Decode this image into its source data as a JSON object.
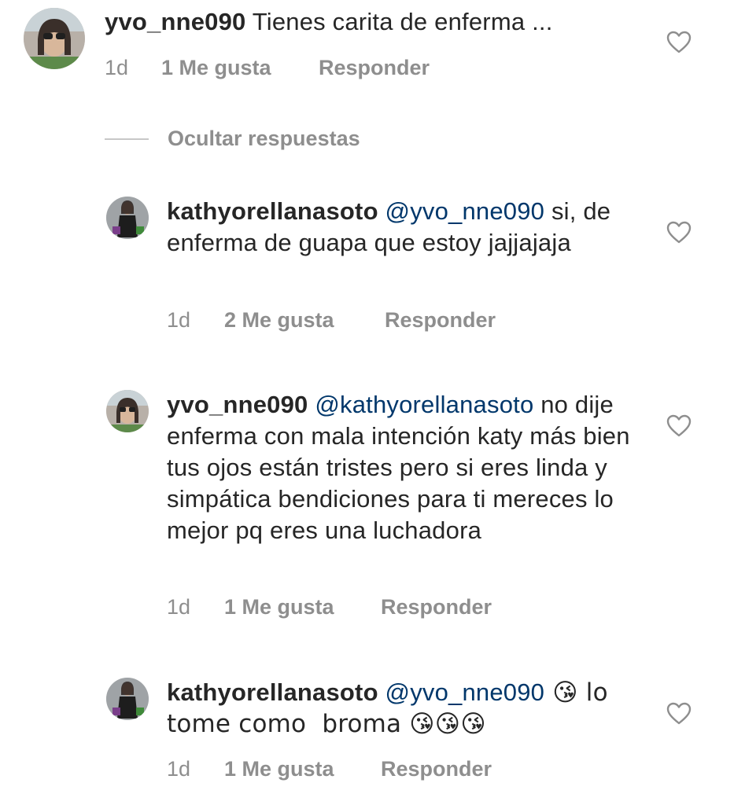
{
  "comments": [
    {
      "username": "yvo_nne090",
      "mention": "",
      "text": " Tienes carita de enferma ...",
      "time": "1d",
      "likes": "1 Me gusta",
      "reply": "Responder"
    },
    {
      "username": "kathyorellanasoto",
      "mention": "@yvo_nne090",
      "text": " si, de enferma de guapa que estoy jajjajaja",
      "time": "1d",
      "likes": "2 Me gusta",
      "reply": "Responder"
    },
    {
      "username": "yvo_nne090",
      "mention": "@kathyorellanasoto",
      "text": " no dije enferma con mala intención katy más bien tus ojos están tristes pero si eres linda y simpática bendiciones para ti mereces lo mejor pq eres una luchadora",
      "time": "1d",
      "likes": "1 Me gusta",
      "reply": "Responder"
    },
    {
      "username": "kathyorellanasoto",
      "mention": "@yvo_nne090",
      "text": " 😘 lo tome como  broma 😘😘😘",
      "time": "1d",
      "likes": "1 Me gusta",
      "reply": "Responder"
    }
  ],
  "replies_toggle": "Ocultar respuestas",
  "icons": {
    "like": "heart-outline-icon"
  },
  "colors": {
    "text": "#262626",
    "secondary": "#8e8e8e",
    "mention": "#00376b"
  }
}
